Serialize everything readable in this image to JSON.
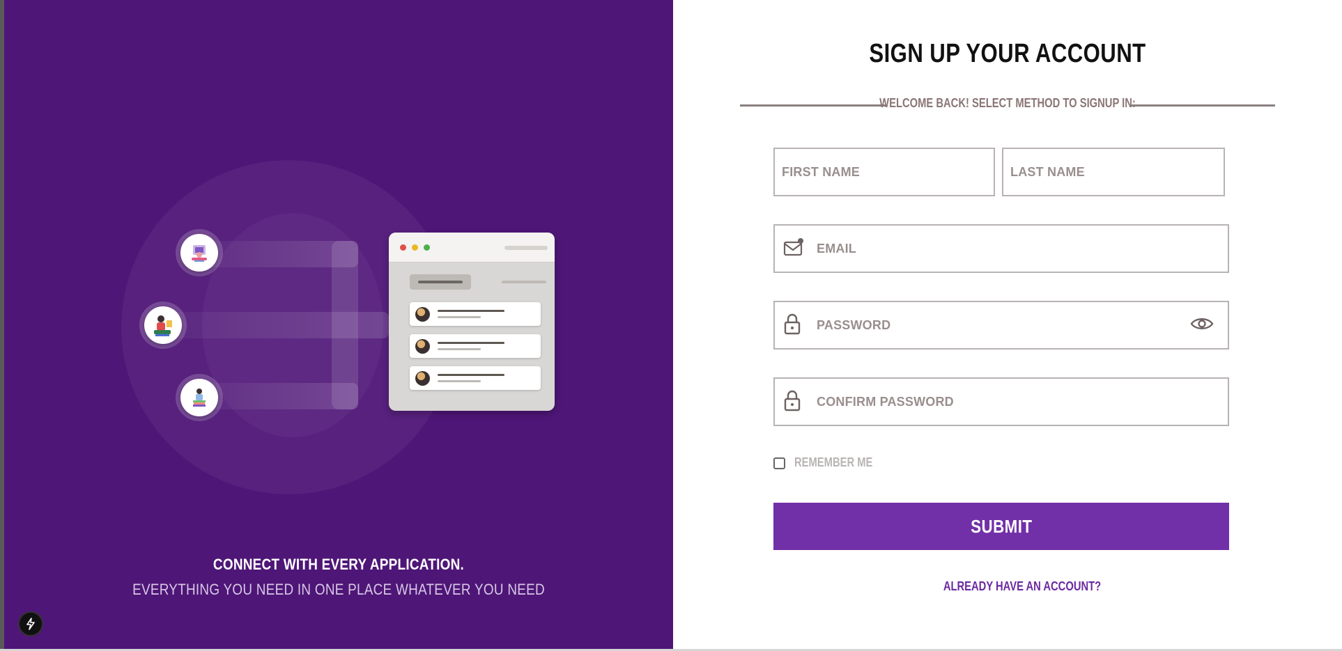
{
  "left": {
    "caption_line1": "CONNECT WITH EVERY APPLICATION.",
    "caption_line2": "EVERYTHING YOU NEED IN ONE PLACE WHATEVER YOU NEED",
    "background_color": "#4e1677"
  },
  "form": {
    "title": "SIGN UP YOUR ACCOUNT",
    "subtitle": "WELCOME BACK! SELECT METHOD TO SIGNUP IN:",
    "first_name_placeholder": "FIRST NAME",
    "last_name_placeholder": "LAST NAME",
    "email_placeholder": "EMAIL",
    "password_placeholder": "PASSWORD",
    "confirm_password_placeholder": "CONFIRM PASSWORD",
    "remember_label": "REMEMBER ME",
    "submit_label": "SUBMIT",
    "already_account_label": "ALREADY HAVE AN ACCOUNT?",
    "accent_color": "#7230a8"
  },
  "icons": {
    "email": "envelope-icon",
    "password": "lock-icon",
    "confirm_password": "lock-icon",
    "toggle_visibility": "eye-icon",
    "badge": "lightning-bolt-icon"
  }
}
